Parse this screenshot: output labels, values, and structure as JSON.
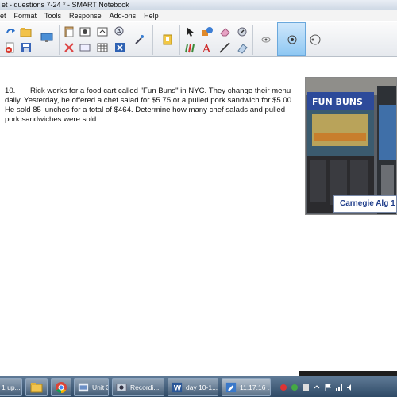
{
  "window": {
    "title": "et - questions 7-24 * - SMART Notebook"
  },
  "menu": [
    "et",
    "Format",
    "Tools",
    "Response",
    "Add-ons",
    "Help"
  ],
  "toolbar": {
    "buttons": [
      "redo-icon",
      "open-icon",
      "delete-page-icon",
      "save-icon",
      "screen-shade-icon",
      "paste-icon",
      "insert-picture-icon",
      "undo-icon",
      "spellcheck-icon",
      "cancel-icon",
      "table-icon",
      "clear-icon",
      "response-icon",
      "select-icon",
      "pen-icon",
      "eraser-icon",
      "magic-pen-icon",
      "creative-pen-icon",
      "text-icon",
      "line-icon",
      "fill-icon",
      "pen-tip-icon",
      "pen-tip-large-icon",
      "pen-tip-outline-icon"
    ]
  },
  "problem": {
    "number": "10.",
    "text": "Rick works for a food cart called \"Fun Buns\" in NYC.  They change their menu daily. Yesterday, he offered a chef salad for $5.75 or a pulled pork sandwich for $5.00. He sold 85 lunches for a total of $464.  Determine how many chef salads and pulled pork sandwiches were sold.."
  },
  "photo": {
    "sign_text": "FUN BUNS",
    "caption": "Carnegie Alg 1"
  },
  "taskbar": {
    "items": [
      {
        "label": "1 up...",
        "icon": "app-icon"
      },
      {
        "label": "",
        "icon": "folder-icon"
      },
      {
        "label": "",
        "icon": "chrome-icon"
      },
      {
        "label": "Unit 3: S...",
        "icon": "presentation-icon"
      },
      {
        "label": "Recordi...",
        "icon": "recorder-icon"
      },
      {
        "label": "day 10-1...",
        "icon": "word-icon"
      },
      {
        "label": "11.17.16 ...",
        "icon": "notebook-icon"
      }
    ]
  },
  "colors": {
    "caption_text": "#1f3d8a",
    "taskbar": "#2f4a66",
    "active_tool": "#8cc6f3"
  }
}
